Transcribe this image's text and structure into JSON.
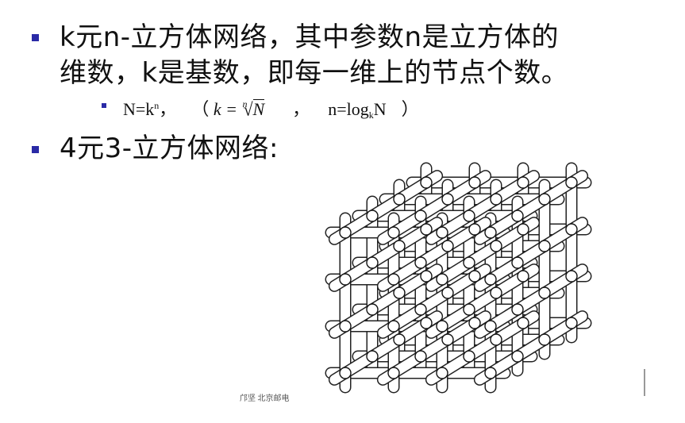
{
  "slide": {
    "bullet_color": "#2a2aa6",
    "bullets": [
      {
        "lines": [
          "k元n-立方体网络，其中参数n是立方体的",
          "维数，k是基数，即每一维上的节点个数。"
        ]
      },
      {
        "lines": [
          "4元3-立方体网络:"
        ]
      }
    ],
    "subbullet": {
      "n_eq": "N=k",
      "n_sup": "n",
      "comma1": "，",
      "open_paren": "（",
      "k_eq": "k =",
      "root_index": "n",
      "root_rad": "N",
      "comma2": "，",
      "n_log": "n=log",
      "log_sub": "k",
      "log_N": "N",
      "close_paren": "）"
    },
    "footer": "邝坚 北京邮电"
  },
  "figure": {
    "icon": "4-ary-3-cube-network-diagram",
    "radix": 4,
    "dimensions": 3
  }
}
